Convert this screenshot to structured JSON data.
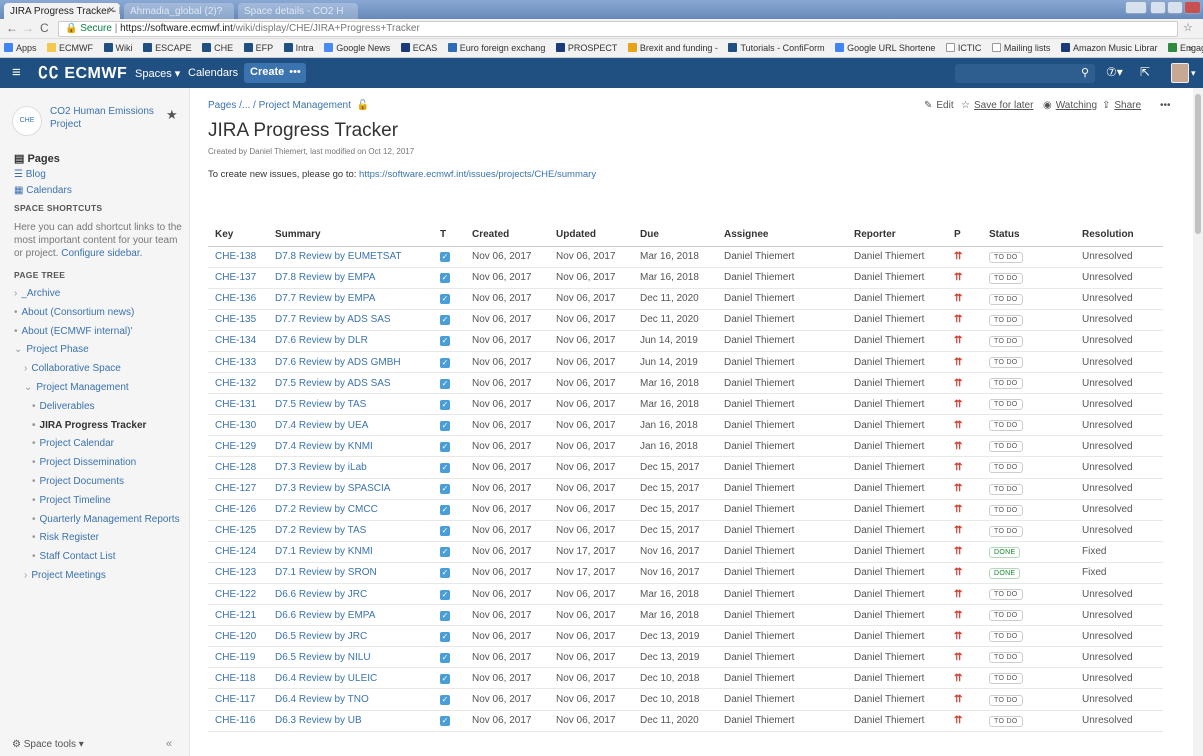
{
  "browser": {
    "active_tab": "JIRA Progress Tracker - E",
    "bg_tabs": [
      "Ahmadia_global (2)?",
      "Space details - CO2 H"
    ],
    "url_secure": "Secure",
    "url_host": "https://software.ecmwf.int",
    "url_path": "/wiki/display/CHE/JIRA+Progress+Tracker",
    "bookmarks": [
      "Apps",
      "ECMWF",
      "Wiki",
      "ESCAPE",
      "CHE",
      "EFP",
      "Intra",
      "Google News",
      "ECAS",
      "Euro foreign exchang",
      "PROSPECT",
      "Brexit and funding -",
      "Tutorials - ConfiForm",
      "Google URL Shortene",
      "ICTIC",
      "Mailing lists",
      "Amazon Music Librar",
      "Engaging_policymak"
    ],
    "more_bookmarks": "»"
  },
  "topnav": {
    "logo": "ECMWF",
    "spaces": "Spaces ▾",
    "calendars": "Calendars",
    "create": "Create",
    "more": "•••"
  },
  "sidebar": {
    "space_name": "CO2 Human Emissions Project",
    "space_icon_text": "CHE",
    "pages": "Pages",
    "blog": "Blog",
    "calendars": "Calendars",
    "shortcuts_head": "SPACE SHORTCUTS",
    "shortcuts_text": "Here you can add shortcut links to the most important content for your team or project.",
    "configure": "Configure sidebar.",
    "tree_head": "PAGE TREE",
    "tree": [
      {
        "label": "_Archive",
        "bullet": "›"
      },
      {
        "label": "About (Consortium news)",
        "bullet": "•"
      },
      {
        "label": "About (ECMWF internal)'",
        "bullet": "•"
      },
      {
        "label": "Project Phase",
        "bullet": "⌄"
      },
      {
        "label": "Collaborative Space",
        "bullet": "›"
      },
      {
        "label": "Project Management",
        "bullet": "⌄"
      },
      {
        "label": "Deliverables",
        "bullet": "•"
      },
      {
        "label": "JIRA Progress Tracker",
        "bullet": "•"
      },
      {
        "label": "Project Calendar",
        "bullet": "•"
      },
      {
        "label": "Project Dissemination",
        "bullet": "•"
      },
      {
        "label": "Project Documents",
        "bullet": "•"
      },
      {
        "label": "Project Timeline",
        "bullet": "•"
      },
      {
        "label": "Quarterly Management Reports",
        "bullet": "•"
      },
      {
        "label": "Risk Register",
        "bullet": "•"
      },
      {
        "label": "Staff Contact List",
        "bullet": "•"
      },
      {
        "label": "Project Meetings",
        "bullet": "›"
      }
    ],
    "space_tools": "Space tools ▾",
    "collapse": "«"
  },
  "page": {
    "breadcrumb": "Pages /... / Project Management",
    "title": "JIRA Progress Tracker",
    "byline": "Created by Daniel Thiemert, last modified on Oct 12, 2017",
    "intro_text": "To create new issues, please go to: ",
    "intro_link": "https://software.ecmwf.int/issues/projects/CHE/summary",
    "actions": {
      "edit": "Edit",
      "save": "Save for later",
      "watching": "Watching",
      "share": "Share",
      "more": "•••"
    }
  },
  "table": {
    "headers": [
      "Key",
      "Summary",
      "T",
      "Created",
      "Updated",
      "Due",
      "Assignee",
      "Reporter",
      "P",
      "Status",
      "Resolution"
    ],
    "rows": [
      [
        "CHE-138",
        "D7.8 Review by EUMETSAT",
        "Nov 06, 2017",
        "Nov 06, 2017",
        "Mar 16, 2018",
        "Daniel Thiemert",
        "Daniel Thiemert",
        "TO DO",
        "Unresolved"
      ],
      [
        "CHE-137",
        "D7.8 Review by EMPA",
        "Nov 06, 2017",
        "Nov 06, 2017",
        "Mar 16, 2018",
        "Daniel Thiemert",
        "Daniel Thiemert",
        "TO DO",
        "Unresolved"
      ],
      [
        "CHE-136",
        "D7.7 Review by EMPA",
        "Nov 06, 2017",
        "Nov 06, 2017",
        "Dec 11, 2020",
        "Daniel Thiemert",
        "Daniel Thiemert",
        "TO DO",
        "Unresolved"
      ],
      [
        "CHE-135",
        "D7.7 Review by ADS SAS",
        "Nov 06, 2017",
        "Nov 06, 2017",
        "Dec 11, 2020",
        "Daniel Thiemert",
        "Daniel Thiemert",
        "TO DO",
        "Unresolved"
      ],
      [
        "CHE-134",
        "D7.6 Review by DLR",
        "Nov 06, 2017",
        "Nov 06, 2017",
        "Jun 14, 2019",
        "Daniel Thiemert",
        "Daniel Thiemert",
        "TO DO",
        "Unresolved"
      ],
      [
        "CHE-133",
        "D7.6 Review by ADS GMBH",
        "Nov 06, 2017",
        "Nov 06, 2017",
        "Jun 14, 2019",
        "Daniel Thiemert",
        "Daniel Thiemert",
        "TO DO",
        "Unresolved"
      ],
      [
        "CHE-132",
        "D7.5 Review by ADS SAS",
        "Nov 06, 2017",
        "Nov 06, 2017",
        "Mar 16, 2018",
        "Daniel Thiemert",
        "Daniel Thiemert",
        "TO DO",
        "Unresolved"
      ],
      [
        "CHE-131",
        "D7.5 Review by TAS",
        "Nov 06, 2017",
        "Nov 06, 2017",
        "Mar 16, 2018",
        "Daniel Thiemert",
        "Daniel Thiemert",
        "TO DO",
        "Unresolved"
      ],
      [
        "CHE-130",
        "D7.4 Review by UEA",
        "Nov 06, 2017",
        "Nov 06, 2017",
        "Jan 16, 2018",
        "Daniel Thiemert",
        "Daniel Thiemert",
        "TO DO",
        "Unresolved"
      ],
      [
        "CHE-129",
        "D7.4 Review by KNMI",
        "Nov 06, 2017",
        "Nov 06, 2017",
        "Jan 16, 2018",
        "Daniel Thiemert",
        "Daniel Thiemert",
        "TO DO",
        "Unresolved"
      ],
      [
        "CHE-128",
        "D7.3 Review by iLab",
        "Nov 06, 2017",
        "Nov 06, 2017",
        "Dec 15, 2017",
        "Daniel Thiemert",
        "Daniel Thiemert",
        "TO DO",
        "Unresolved"
      ],
      [
        "CHE-127",
        "D7.3 Review by SPASCIA",
        "Nov 06, 2017",
        "Nov 06, 2017",
        "Dec 15, 2017",
        "Daniel Thiemert",
        "Daniel Thiemert",
        "TO DO",
        "Unresolved"
      ],
      [
        "CHE-126",
        "D7.2 Review by CMCC",
        "Nov 06, 2017",
        "Nov 06, 2017",
        "Dec 15, 2017",
        "Daniel Thiemert",
        "Daniel Thiemert",
        "TO DO",
        "Unresolved"
      ],
      [
        "CHE-125",
        "D7.2 Review by TAS",
        "Nov 06, 2017",
        "Nov 06, 2017",
        "Dec 15, 2017",
        "Daniel Thiemert",
        "Daniel Thiemert",
        "TO DO",
        "Unresolved"
      ],
      [
        "CHE-124",
        "D7.1 Review by KNMI",
        "Nov 06, 2017",
        "Nov 17, 2017",
        "Nov 16, 2017",
        "Daniel Thiemert",
        "Daniel Thiemert",
        "DONE",
        "Fixed"
      ],
      [
        "CHE-123",
        "D7.1 Review by SRON",
        "Nov 06, 2017",
        "Nov 17, 2017",
        "Nov 16, 2017",
        "Daniel Thiemert",
        "Daniel Thiemert",
        "DONE",
        "Fixed"
      ],
      [
        "CHE-122",
        "D6.6 Review by JRC",
        "Nov 06, 2017",
        "Nov 06, 2017",
        "Mar 16, 2018",
        "Daniel Thiemert",
        "Daniel Thiemert",
        "TO DO",
        "Unresolved"
      ],
      [
        "CHE-121",
        "D6.6 Review by EMPA",
        "Nov 06, 2017",
        "Nov 06, 2017",
        "Mar 16, 2018",
        "Daniel Thiemert",
        "Daniel Thiemert",
        "TO DO",
        "Unresolved"
      ],
      [
        "CHE-120",
        "D6.5 Review by JRC",
        "Nov 06, 2017",
        "Nov 06, 2017",
        "Dec 13, 2019",
        "Daniel Thiemert",
        "Daniel Thiemert",
        "TO DO",
        "Unresolved"
      ],
      [
        "CHE-119",
        "D6.5 Review by NILU",
        "Nov 06, 2017",
        "Nov 06, 2017",
        "Dec 13, 2019",
        "Daniel Thiemert",
        "Daniel Thiemert",
        "TO DO",
        "Unresolved"
      ],
      [
        "CHE-118",
        "D6.4 Review by ULEIC",
        "Nov 06, 2017",
        "Nov 06, 2017",
        "Dec 10, 2018",
        "Daniel Thiemert",
        "Daniel Thiemert",
        "TO DO",
        "Unresolved"
      ],
      [
        "CHE-117",
        "D6.4 Review by TNO",
        "Nov 06, 2017",
        "Nov 06, 2017",
        "Dec 10, 2018",
        "Daniel Thiemert",
        "Daniel Thiemert",
        "TO DO",
        "Unresolved"
      ],
      [
        "CHE-116",
        "D6.3 Review by UB",
        "Nov 06, 2017",
        "Nov 06, 2017",
        "Dec 11, 2020",
        "Daniel Thiemert",
        "Daniel Thiemert",
        "TO DO",
        "Unresolved"
      ]
    ]
  },
  "colors": {
    "header": "#205081",
    "link": "#3b73af",
    "priority": "#d04437",
    "done": "#14892c"
  }
}
